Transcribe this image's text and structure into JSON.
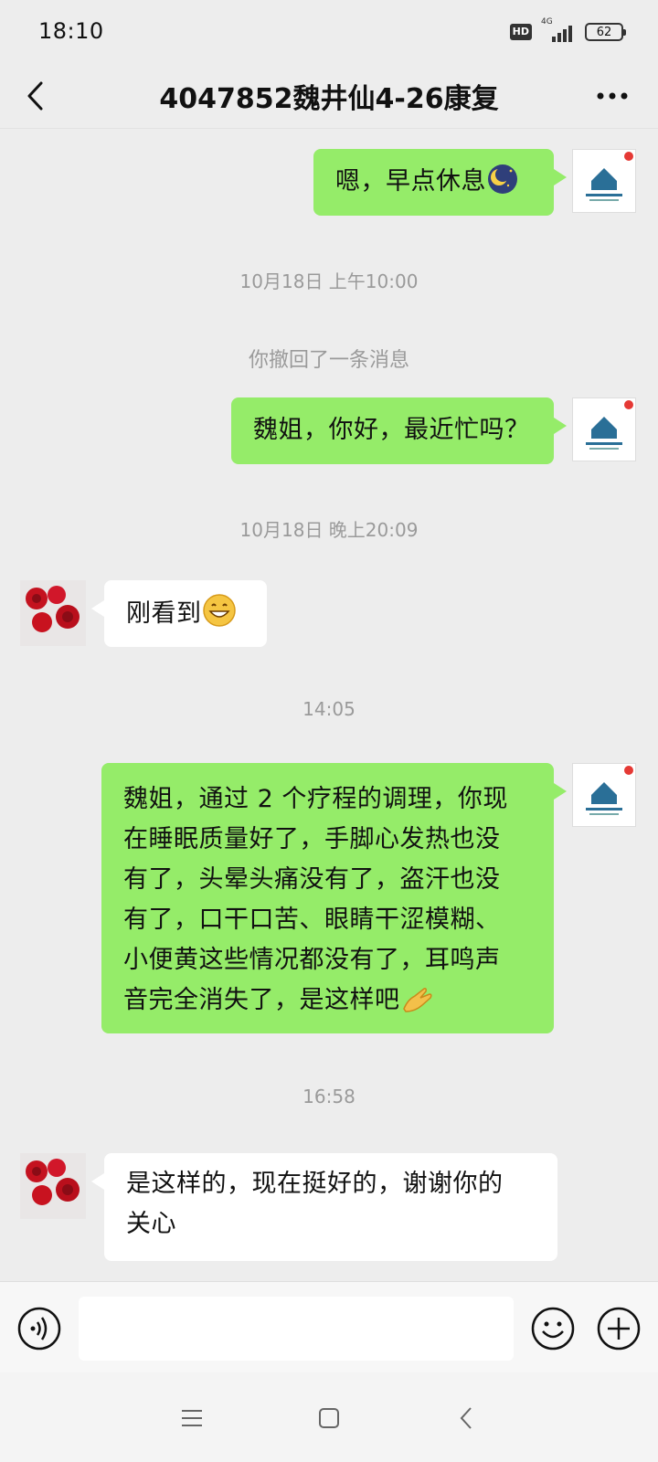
{
  "status_bar": {
    "time": "18:10",
    "hd": "HD",
    "network": "4G",
    "battery": "62"
  },
  "header": {
    "title": "4047852魏井仙4-26康复"
  },
  "messages": [
    {
      "side": "me",
      "text": "嗯，早点休息"
    },
    {
      "timestamp": "10月18日 上午10:00"
    },
    {
      "system": "你撤回了一条消息"
    },
    {
      "side": "me",
      "text": "魏姐，你好，最近忙吗？"
    },
    {
      "timestamp": "10月18日 晚上20:09"
    },
    {
      "side": "other",
      "text": "刚看到"
    },
    {
      "timestamp": "14:05"
    },
    {
      "side": "me",
      "lines": [
        "魏姐，通过 2 个疗程的调理，你现",
        "在睡眠质量好了，手脚心发热也没",
        "有了，头晕头痛没有了，盗汗也没",
        "有了，口干口苦、眼睛干涩模糊、",
        "小便黄这些情况都没有了，耳鸣声",
        "音完全消失了，是这样吧"
      ]
    },
    {
      "timestamp": "16:58"
    },
    {
      "side": "other",
      "lines": [
        "是这样的，现在挺好的，谢谢你的",
        "关心"
      ]
    }
  ],
  "input": {
    "placeholder": ""
  },
  "colors": {
    "my_bubble": "#95ec69",
    "other_bubble": "#ffffff",
    "background": "#ededed",
    "timestamp_text": "#9a9a9a"
  },
  "icons": [
    "back-arrow-icon",
    "more-icon",
    "moon-emoji-icon",
    "grin-emoji-icon",
    "ok-hand-emoji-icon",
    "voice-icon",
    "emoji-icon",
    "plus-icon",
    "menu-icon",
    "home-icon",
    "back-icon"
  ]
}
